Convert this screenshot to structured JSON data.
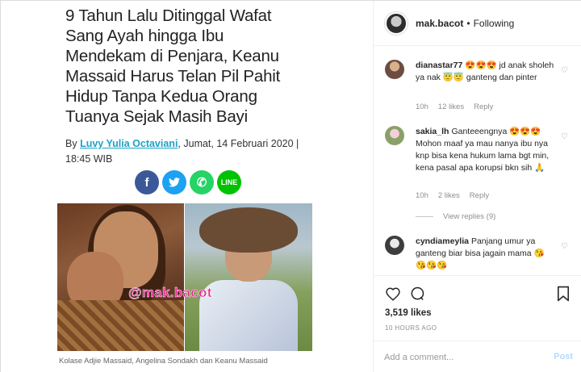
{
  "article": {
    "headline": "9 Tahun Lalu Ditinggal Wafat Sang Ayah hingga Ibu Mendekam di Penjara, Keanu Massaid Harus Telan Pil Pahit Hidup Tanpa Kedua Orang Tuanya Sejak Masih Bayi",
    "by_prefix": "By ",
    "author": "Luvy Yulia Octaviani",
    "date": ", Jumat, 14 Februari 2020 | 18:45 WIB",
    "share_buttons": [
      {
        "icon": "facebook-icon",
        "glyph": "f",
        "color": "#3b5998"
      },
      {
        "icon": "twitter-icon",
        "glyph": "t",
        "color": "#1da1f2"
      },
      {
        "icon": "whatsapp-icon",
        "glyph": "✆",
        "color": "#25d366"
      },
      {
        "icon": "line-icon",
        "glyph": "LINE",
        "color": "#00c300"
      }
    ],
    "watermark": "@mak.bacot",
    "caption": "Kolase Adjie Massaid, Angelina Sondakh dan Keanu Massaid"
  },
  "post_header": {
    "username": "mak.bacot",
    "separator": "•",
    "follow_status": "Following"
  },
  "comments": [
    {
      "username": "dianastar77",
      "text": "😍😍😍 jd anak sholeh ya nak 😇😇 ganteng dan pinter",
      "time": "10h",
      "likes": "12 likes",
      "reply": "Reply"
    },
    {
      "username": "sakia_lh",
      "text": "Ganteeengnya 😍😍😍 Mohon maaf ya mau nanya ibu nya knp bisa kena hukum lama bgt min, kena pasal apa korupsi bkn sih 🙏",
      "time": "10h",
      "likes": "2 likes",
      "reply": "Reply",
      "view_replies": "View replies (9)"
    },
    {
      "username": "cyndiameylia",
      "text": "Panjang umur ya ganteng biar bisa jagain mama 😘 😘😘😘"
    }
  ],
  "actions": {
    "likes": "3,519 likes",
    "time_ago": "10 HOURS AGO",
    "add_comment_placeholder": "Add a comment...",
    "post_label": "Post"
  },
  "colors": {
    "link": "#1aa3c9",
    "post_disabled": "#b3dbff",
    "muted": "#8e8e8e"
  }
}
